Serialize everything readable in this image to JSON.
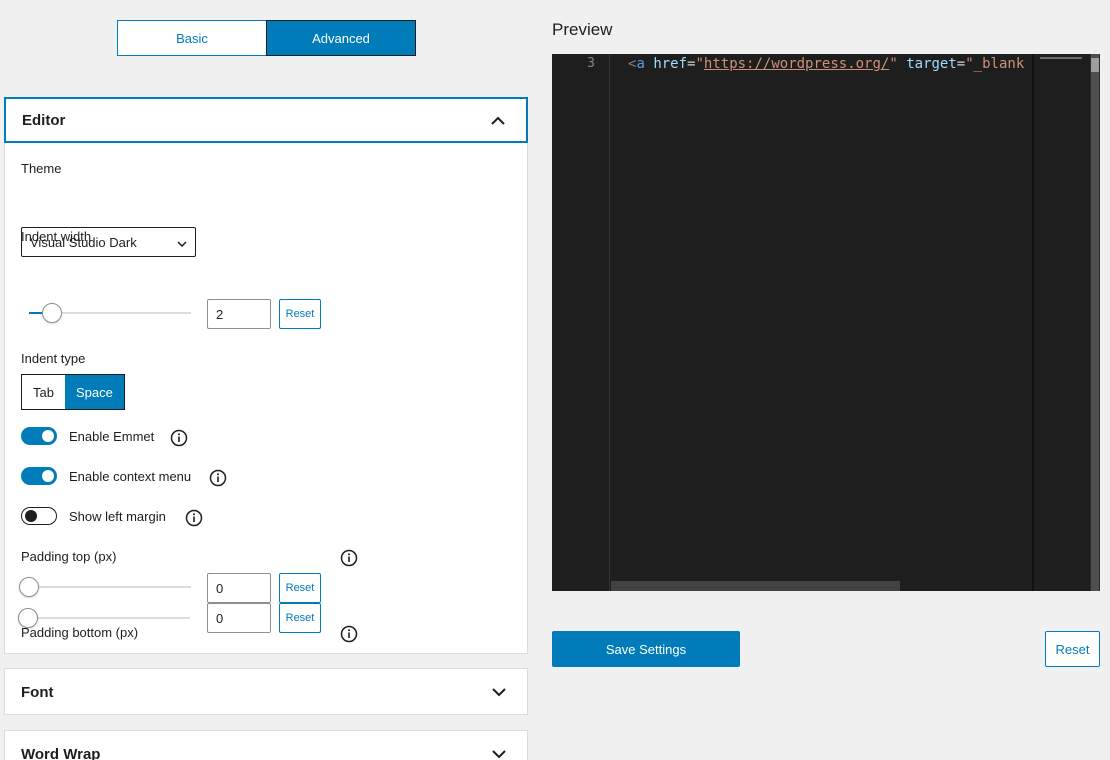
{
  "mode_switch": {
    "basic_label": "Basic",
    "advanced_label": "Advanced",
    "selected": "Advanced"
  },
  "editor_panel": {
    "title": "Editor",
    "theme": {
      "label": "Theme",
      "value": "Visual Studio Dark"
    },
    "indent_width": {
      "label": "Indent width",
      "value": "2",
      "reset_label": "Reset",
      "slider_fraction": 0.14
    },
    "indent_type": {
      "label": "Indent type",
      "options": [
        "Tab",
        "Space"
      ],
      "selected": "Space"
    },
    "toggles": [
      {
        "label": "Enable Emmet",
        "on": true
      },
      {
        "label": "Enable context menu",
        "on": true
      },
      {
        "label": "Show left margin",
        "on": false
      }
    ],
    "padding_top": {
      "label": "Padding top (px)",
      "value": "0",
      "reset_label": "Reset",
      "slider_fraction": 0
    },
    "padding_bottom": {
      "label": "Padding bottom (px)",
      "value": "0",
      "reset_label": "Reset",
      "slider_fraction": 0
    }
  },
  "font_panel": {
    "title": "Font"
  },
  "wordwrap_panel": {
    "title": "Word Wrap"
  },
  "preview": {
    "title": "Preview",
    "line_number": "3",
    "code": {
      "open": "<",
      "tag": "a",
      "attr1": "href",
      "eq": "=",
      "q": "\"",
      "url": "https://wordpress.org/",
      "attr2": "target",
      "val2_partial": "_blank"
    }
  },
  "actions": {
    "save_label": "Save Settings",
    "reset_label": "Reset"
  },
  "colors": {
    "accent": "#007cba",
    "editor_bg": "#1e1e1e"
  }
}
